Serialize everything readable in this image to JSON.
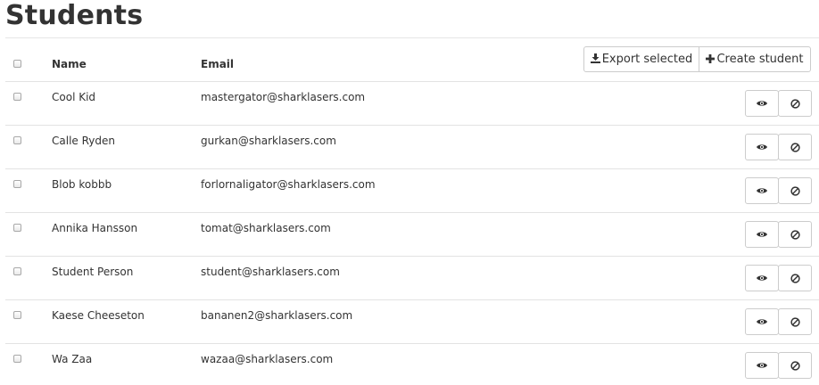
{
  "page": {
    "title": "Students"
  },
  "toolbar": {
    "export_label": "Export selected",
    "create_label": "Create student",
    "export_icon": "download-icon",
    "create_icon": "plus-icon"
  },
  "table": {
    "columns": [
      "Name",
      "Email"
    ],
    "rows": [
      {
        "name": "Cool Kid",
        "email": "mastergator@sharklasers.com"
      },
      {
        "name": "Calle Ryden",
        "email": "gurkan@sharklasers.com"
      },
      {
        "name": "Blob kobbb",
        "email": "forlornaligator@sharklasers.com"
      },
      {
        "name": "Annika Hansson",
        "email": "tomat@sharklasers.com"
      },
      {
        "name": "Student Person",
        "email": "student@sharklasers.com"
      },
      {
        "name": "Kaese Cheeseton",
        "email": "bananen2@sharklasers.com"
      },
      {
        "name": "Wa Zaa",
        "email": "wazaa@sharklasers.com"
      }
    ],
    "row_actions": [
      "view-eye-icon",
      "block-ban-icon"
    ]
  }
}
